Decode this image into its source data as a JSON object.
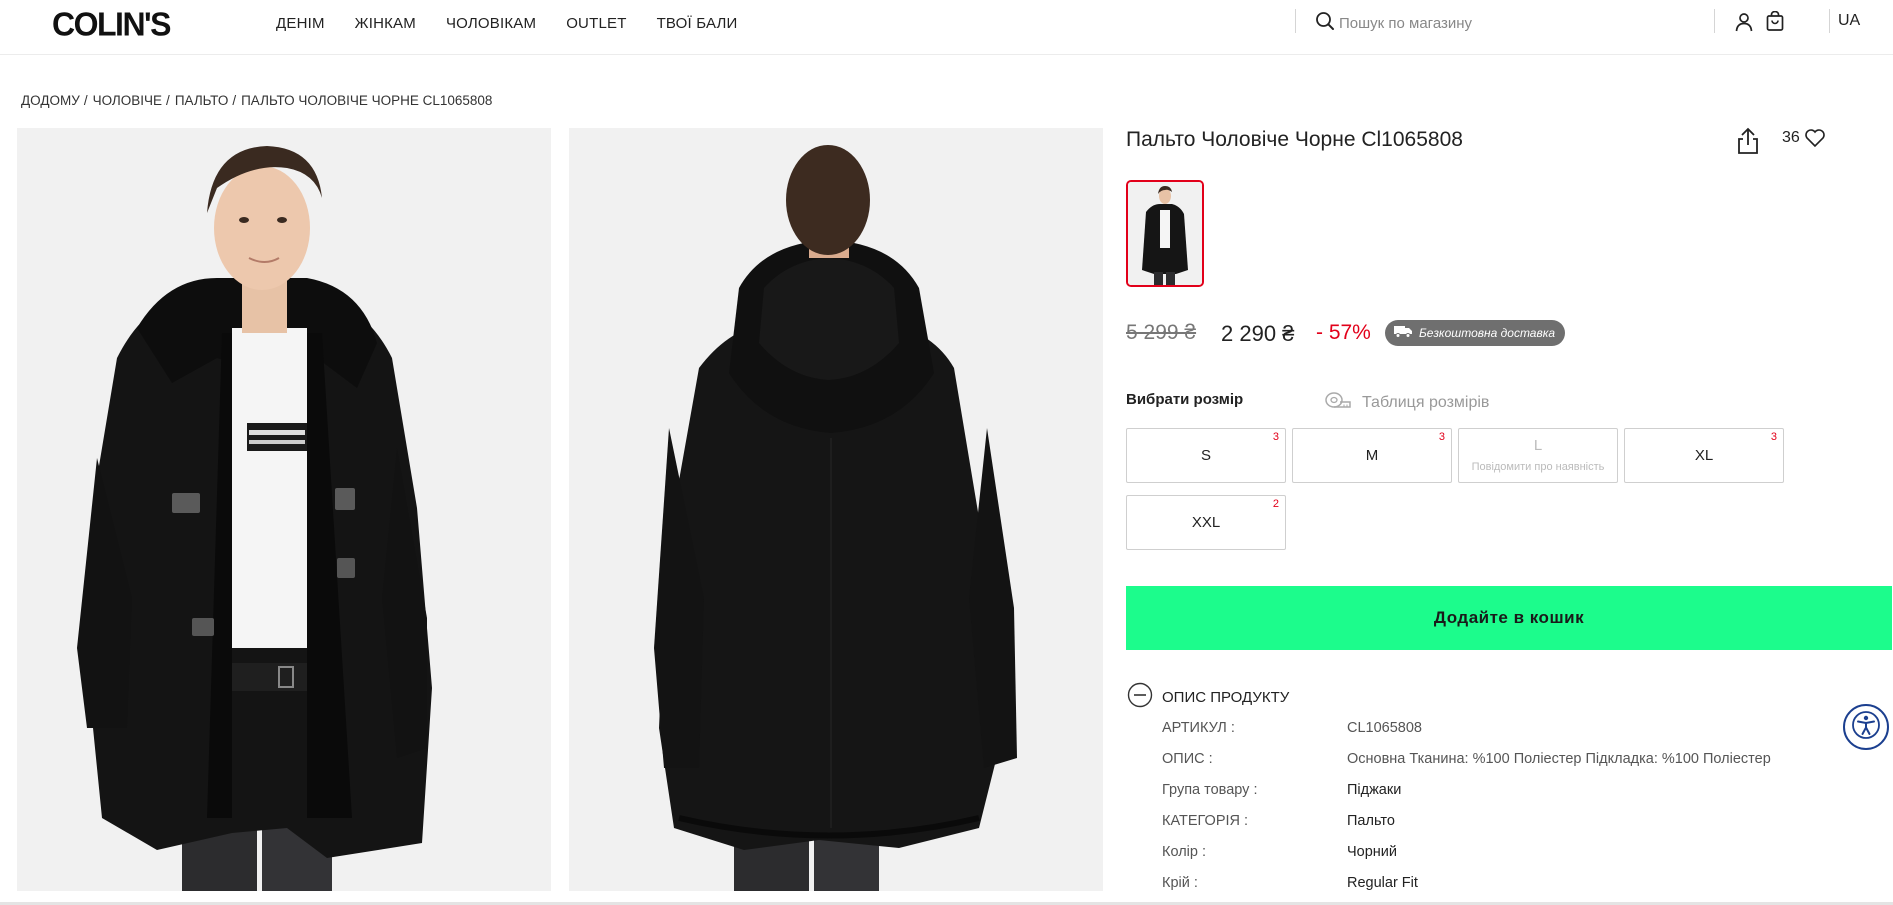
{
  "header": {
    "logo": "COLIN'S",
    "nav": [
      "ДЕНІМ",
      "ЖІНКАМ",
      "ЧОЛОВІКАМ",
      "OUTLET",
      "ТВОЇ БАЛИ"
    ],
    "search_placeholder": "Пошук по магазину",
    "language": "UA"
  },
  "breadcrumb": {
    "home": "ДОДОМУ",
    "men": "ЧОЛОВІЧЕ",
    "coats": "ПАЛЬТО",
    "current": "ПАЛЬТО ЧОЛОВІЧЕ ЧОРНЕ CL1065808",
    "separator": "/"
  },
  "product": {
    "title": "Пальто Чоловіче Чорне Cl1065808",
    "favorites_count": "36",
    "old_price": "5 299 ₴",
    "new_price": "2 290 ₴",
    "discount": "- 57%",
    "free_delivery": "Безкоштовна доставка",
    "choose_size": "Вибрати розмір",
    "size_table": "Таблиця розмірів",
    "sizes": [
      {
        "label": "S",
        "count": "3"
      },
      {
        "label": "M",
        "count": "3"
      },
      {
        "label": "L",
        "notify": "Повідомити про наявність"
      },
      {
        "label": "XL",
        "count": "3"
      },
      {
        "label": "XXL",
        "count": "2"
      }
    ],
    "add_to_cart": "Додайте в кошик",
    "description_title": "ОПИС ПРОДУКТУ",
    "attributes": [
      {
        "key": "АРТИКУЛ :",
        "value": "CL1065808"
      },
      {
        "key": "ОПИС :",
        "value": "Основна Тканина: %100 Поліестер Підкладка: %100 Поліестер"
      },
      {
        "key": "Група товару :",
        "value": "Піджаки"
      },
      {
        "key": "КАТЕГОРІЯ :",
        "value": "Пальто"
      },
      {
        "key": "Колір :",
        "value": "Чорний"
      },
      {
        "key": "Крій :",
        "value": "Regular Fit"
      }
    ]
  },
  "colors": {
    "accent_green": "#1cfc8c",
    "sale_red": "#e2001a",
    "badge_grey": "#6f6f6f"
  },
  "icons": [
    "search-icon",
    "user-icon",
    "bag-icon",
    "share-icon",
    "heart-icon",
    "truck-icon",
    "measuring-tape-icon",
    "minus-circle-icon",
    "accessibility-icon"
  ]
}
